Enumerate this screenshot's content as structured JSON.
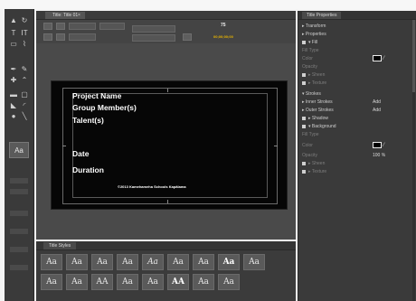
{
  "main_panel": {
    "tab_label": "Title: Title 01",
    "tab_close": "×",
    "font_size_value": "75",
    "timecode": "00;00;00;00"
  },
  "canvas": {
    "project_name": "Project Name",
    "group_members": "Group Member(s)",
    "talent": "Talent(s)",
    "date": "Date",
    "duration": "Duration",
    "credit": "©2013 Kamehameha Schools Kapālama"
  },
  "tools": {
    "selected_tool": "Aa"
  },
  "styles_panel": {
    "tab_label": "Title Styles",
    "swatches": [
      "Aa",
      "Aa",
      "Aa",
      "Aa",
      "Aa",
      "Aa",
      "Aa",
      "Aa",
      "Aa",
      "Aa",
      "Aa",
      "AA",
      "Aa",
      "Aa",
      "AA",
      "Aa",
      "Aa"
    ]
  },
  "properties_panel": {
    "tab_label": "Title Properties",
    "rows": {
      "transform": "Transform",
      "properties": "Properties",
      "fill": "Fill",
      "fill_type": "Fill Type",
      "color": "Color",
      "opacity": "Opacity",
      "sheen": "Sheen",
      "texture": "Texture",
      "strokes": "Strokes",
      "inner_strokes": "Inner Strokes",
      "outer_strokes": "Outer Strokes",
      "shadow": "Shadow",
      "background": "Background",
      "bg_fill_type": "Fill Type",
      "bg_color": "Color",
      "bg_opacity": "Opacity",
      "bg_sheen": "Sheen",
      "bg_texture": "Texture"
    },
    "values": {
      "inner_strokes_add": "Add",
      "outer_strokes_add": "Add",
      "bg_opacity_value": "100 %"
    },
    "accent_color": "#000000"
  }
}
